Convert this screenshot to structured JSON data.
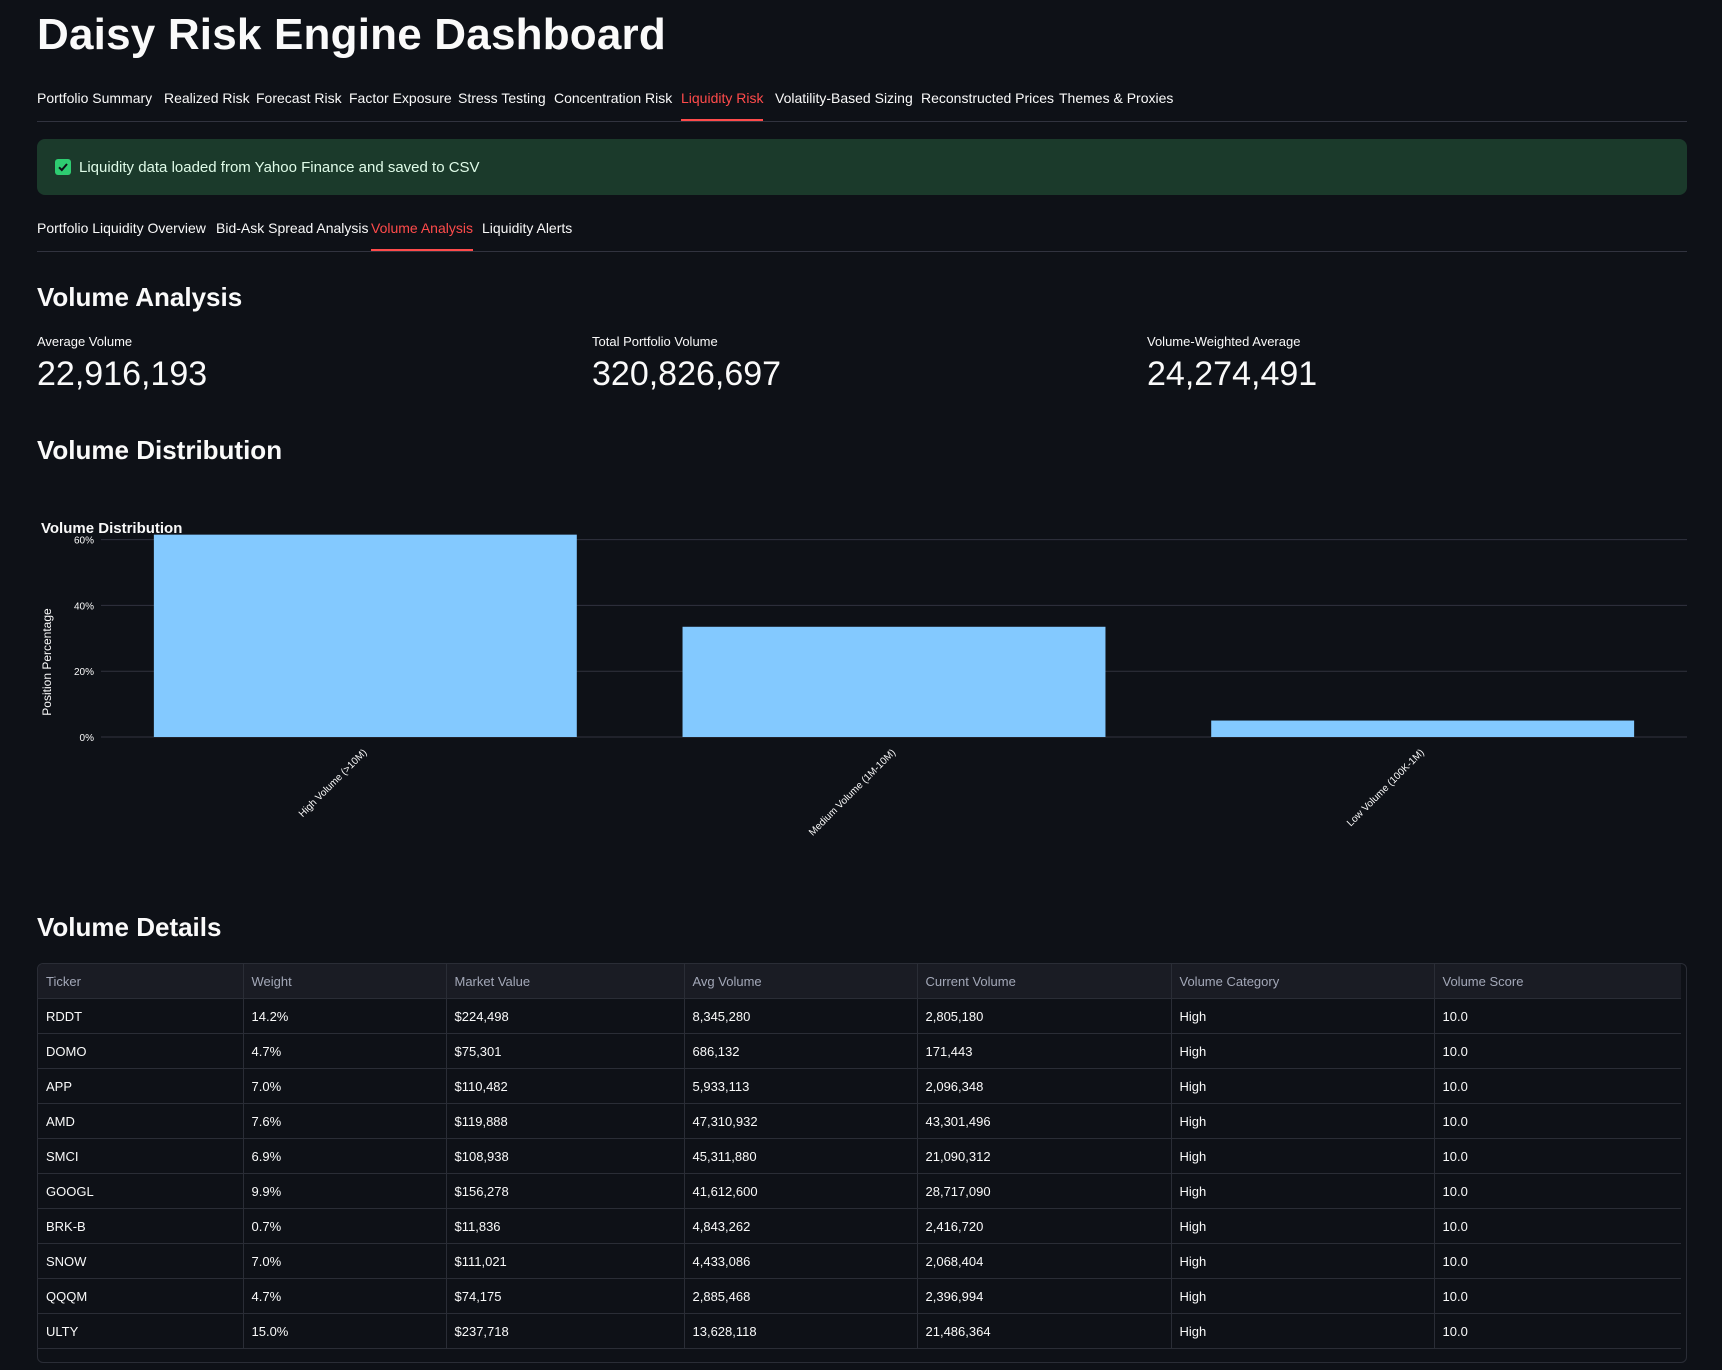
{
  "app": {
    "title": "Daisy Risk Engine Dashboard"
  },
  "main_tabs": [
    {
      "label": "Portfolio Summary",
      "active": false
    },
    {
      "label": "Realized Risk",
      "active": false
    },
    {
      "label": "Forecast Risk",
      "active": false
    },
    {
      "label": "Factor Exposure",
      "active": false
    },
    {
      "label": "Stress Testing",
      "active": false
    },
    {
      "label": "Concentration Risk",
      "active": false
    },
    {
      "label": "Liquidity Risk",
      "active": true
    },
    {
      "label": "Volatility-Based Sizing",
      "active": false
    },
    {
      "label": "Reconstructed Prices",
      "active": false
    },
    {
      "label": "Themes & Proxies",
      "active": false
    }
  ],
  "alert": {
    "icon": "check-icon",
    "text": "Liquidity data loaded from Yahoo Finance and saved to CSV"
  },
  "sub_tabs": [
    {
      "label": "Portfolio Liquidity Overview",
      "active": false
    },
    {
      "label": "Bid-Ask Spread Analysis",
      "active": false
    },
    {
      "label": "Volume Analysis",
      "active": true
    },
    {
      "label": "Liquidity Alerts",
      "active": false
    }
  ],
  "volume_analysis": {
    "heading": "Volume Analysis",
    "metrics": [
      {
        "label": "Average Volume",
        "value": "22,916,193"
      },
      {
        "label": "Total Portfolio Volume",
        "value": "320,826,697"
      },
      {
        "label": "Volume-Weighted Average",
        "value": "24,274,491"
      }
    ]
  },
  "distribution": {
    "heading": "Volume Distribution"
  },
  "chart_data": {
    "type": "bar",
    "title": "Volume Distribution",
    "ylabel": "Position Percentage",
    "xlabel": "",
    "categories": [
      "High Volume (>10M)",
      "Medium Volume (1M-10M)",
      "Low Volume (100K-1M)"
    ],
    "values": [
      61.5,
      33.5,
      5.0
    ],
    "ylim": [
      0,
      62
    ],
    "yticks": [
      0,
      20,
      40,
      60
    ],
    "ytick_labels": [
      "0%",
      "20%",
      "40%",
      "60%"
    ],
    "bar_color": "#83c9ff",
    "grid": true
  },
  "details": {
    "heading": "Volume Details",
    "columns": [
      "Ticker",
      "Weight",
      "Market Value",
      "Avg Volume",
      "Current Volume",
      "Volume Category",
      "Volume Score"
    ],
    "rows": [
      [
        "RDDT",
        "14.2%",
        "$224,498",
        "8,345,280",
        "2,805,180",
        "High",
        "10.0"
      ],
      [
        "DOMO",
        "4.7%",
        "$75,301",
        "686,132",
        "171,443",
        "High",
        "10.0"
      ],
      [
        "APP",
        "7.0%",
        "$110,482",
        "5,933,113",
        "2,096,348",
        "High",
        "10.0"
      ],
      [
        "AMD",
        "7.6%",
        "$119,888",
        "47,310,932",
        "43,301,496",
        "High",
        "10.0"
      ],
      [
        "SMCI",
        "6.9%",
        "$108,938",
        "45,311,880",
        "21,090,312",
        "High",
        "10.0"
      ],
      [
        "GOOGL",
        "9.9%",
        "$156,278",
        "41,612,600",
        "28,717,090",
        "High",
        "10.0"
      ],
      [
        "BRK-B",
        "0.7%",
        "$11,836",
        "4,843,262",
        "2,416,720",
        "High",
        "10.0"
      ],
      [
        "SNOW",
        "7.0%",
        "$111,021",
        "4,433,086",
        "2,068,404",
        "High",
        "10.0"
      ],
      [
        "QQQM",
        "4.7%",
        "$74,175",
        "2,885,468",
        "2,396,994",
        "High",
        "10.0"
      ],
      [
        "ULTY",
        "15.0%",
        "$237,718",
        "13,628,118",
        "21,486,364",
        "High",
        "10.0"
      ]
    ]
  }
}
